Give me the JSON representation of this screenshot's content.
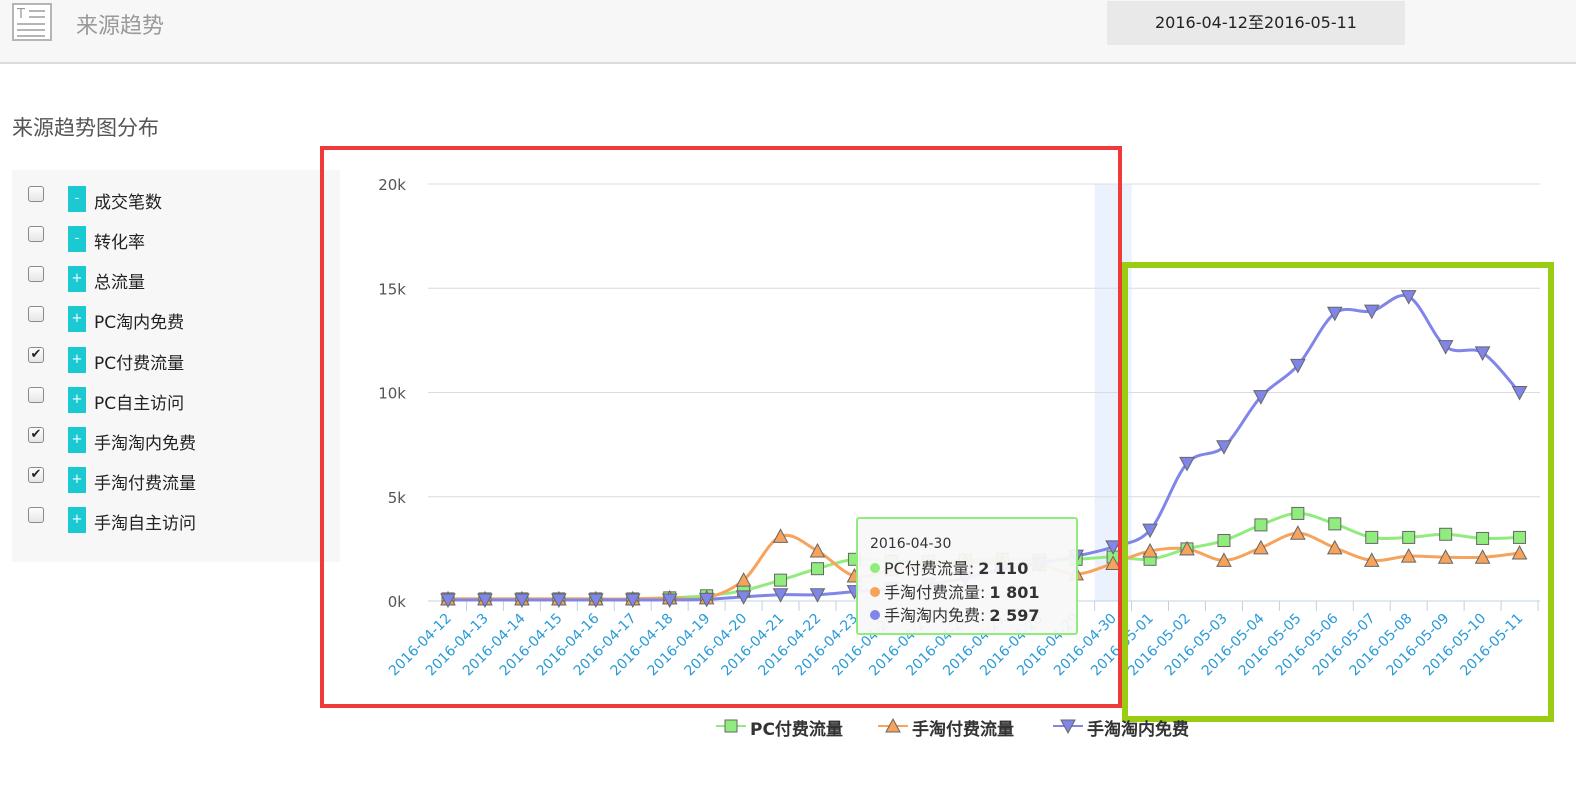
{
  "header": {
    "title": "来源趋势",
    "date_range": "2016-04-12至2016-05-11",
    "doc_icon_letter": "T"
  },
  "section_title": "来源趋势图分布",
  "metrics": [
    {
      "label": "成交笔数",
      "checked": false,
      "toggle": "-"
    },
    {
      "label": "转化率",
      "checked": false,
      "toggle": "-"
    },
    {
      "label": "总流量",
      "checked": false,
      "toggle": "+"
    },
    {
      "label": "PC淘内免费",
      "checked": false,
      "toggle": "+"
    },
    {
      "label": "PC付费流量",
      "checked": true,
      "toggle": "+"
    },
    {
      "label": "PC自主访问",
      "checked": false,
      "toggle": "+"
    },
    {
      "label": "手淘淘内免费",
      "checked": true,
      "toggle": "+"
    },
    {
      "label": "手淘付费流量",
      "checked": true,
      "toggle": "+"
    },
    {
      "label": "手淘自主访问",
      "checked": false,
      "toggle": "+"
    }
  ],
  "tooltip": {
    "date": "2016-04-30",
    "rows": [
      {
        "label": "PC付费流量:",
        "value": "2 110",
        "color": "#90ed7d"
      },
      {
        "label": "手淘付费流量:",
        "value": "1 801",
        "color": "#f7a35c"
      },
      {
        "label": "手淘淘内免费:",
        "value": "2 597",
        "color": "#8085e9"
      }
    ]
  },
  "chart_data": {
    "type": "line",
    "x": [
      "2016-04-12",
      "2016-04-13",
      "2016-04-14",
      "2016-04-15",
      "2016-04-16",
      "2016-04-17",
      "2016-04-18",
      "2016-04-19",
      "2016-04-20",
      "2016-04-21",
      "2016-04-22",
      "2016-04-23",
      "2016-04-24",
      "2016-04-25",
      "2016-04-26",
      "2016-04-27",
      "2016-04-28",
      "2016-04-29",
      "2016-04-30",
      "2016-05-01",
      "2016-05-02",
      "2016-05-03",
      "2016-05-04",
      "2016-05-05",
      "2016-05-06",
      "2016-05-07",
      "2016-05-08",
      "2016-05-09",
      "2016-05-10",
      "2016-05-11"
    ],
    "yticks": [
      "0k",
      "5k",
      "10k",
      "15k",
      "20k"
    ],
    "ylim": [
      0,
      20000
    ],
    "grid": true,
    "legend_position": "bottom-center",
    "highlight_category": "2016-04-30",
    "series": [
      {
        "name": "PC付费流量",
        "color": "#90ed7d",
        "marker": "square",
        "values": [
          100,
          100,
          100,
          100,
          100,
          100,
          150,
          250,
          500,
          1000,
          1550,
          2000,
          1900,
          1900,
          1950,
          2000,
          1950,
          2000,
          2110,
          2000,
          2500,
          2900,
          3650,
          4200,
          3700,
          3050,
          3050,
          3200,
          3000,
          3050
        ]
      },
      {
        "name": "手淘付费流量",
        "color": "#f7a35c",
        "marker": "triangle",
        "values": [
          100,
          100,
          100,
          100,
          100,
          100,
          150,
          150,
          1000,
          3100,
          2400,
          1200,
          1500,
          1700,
          1850,
          1800,
          1750,
          1300,
          1801,
          2400,
          2500,
          1950,
          2550,
          3250,
          2550,
          1950,
          2150,
          2100,
          2100,
          2300
        ]
      },
      {
        "name": "手淘淘内免费",
        "color": "#8085e9",
        "marker": "triangle-down",
        "values": [
          50,
          50,
          50,
          50,
          50,
          50,
          50,
          80,
          200,
          300,
          300,
          450,
          600,
          800,
          1100,
          1500,
          1800,
          2150,
          2597,
          3400,
          6600,
          7400,
          9800,
          11300,
          13800,
          13900,
          14600,
          12200,
          11900,
          10000
        ]
      }
    ]
  }
}
